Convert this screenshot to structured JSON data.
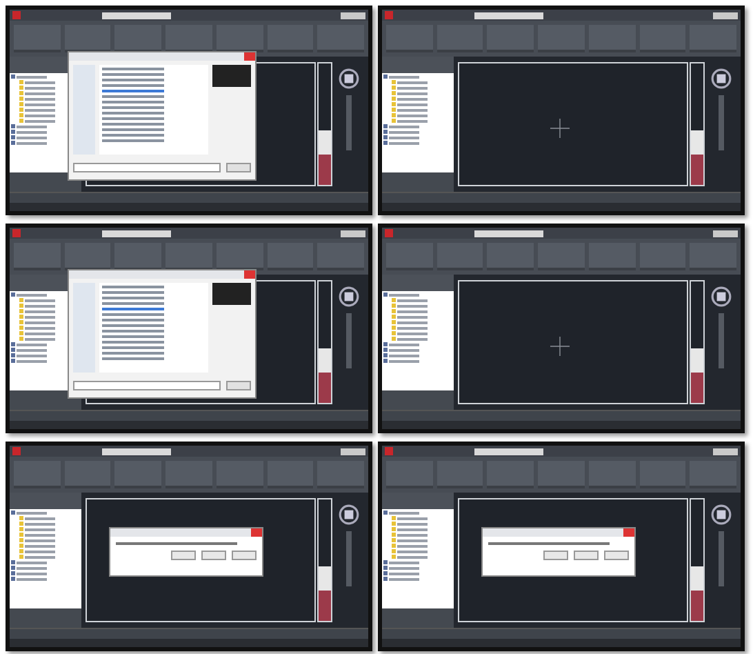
{
  "panels": [
    {
      "kind": "open-dialog"
    },
    {
      "kind": "drawing"
    },
    {
      "kind": "open-dialog"
    },
    {
      "kind": "drawing"
    },
    {
      "kind": "save-prompt"
    },
    {
      "kind": "save-prompt"
    }
  ]
}
